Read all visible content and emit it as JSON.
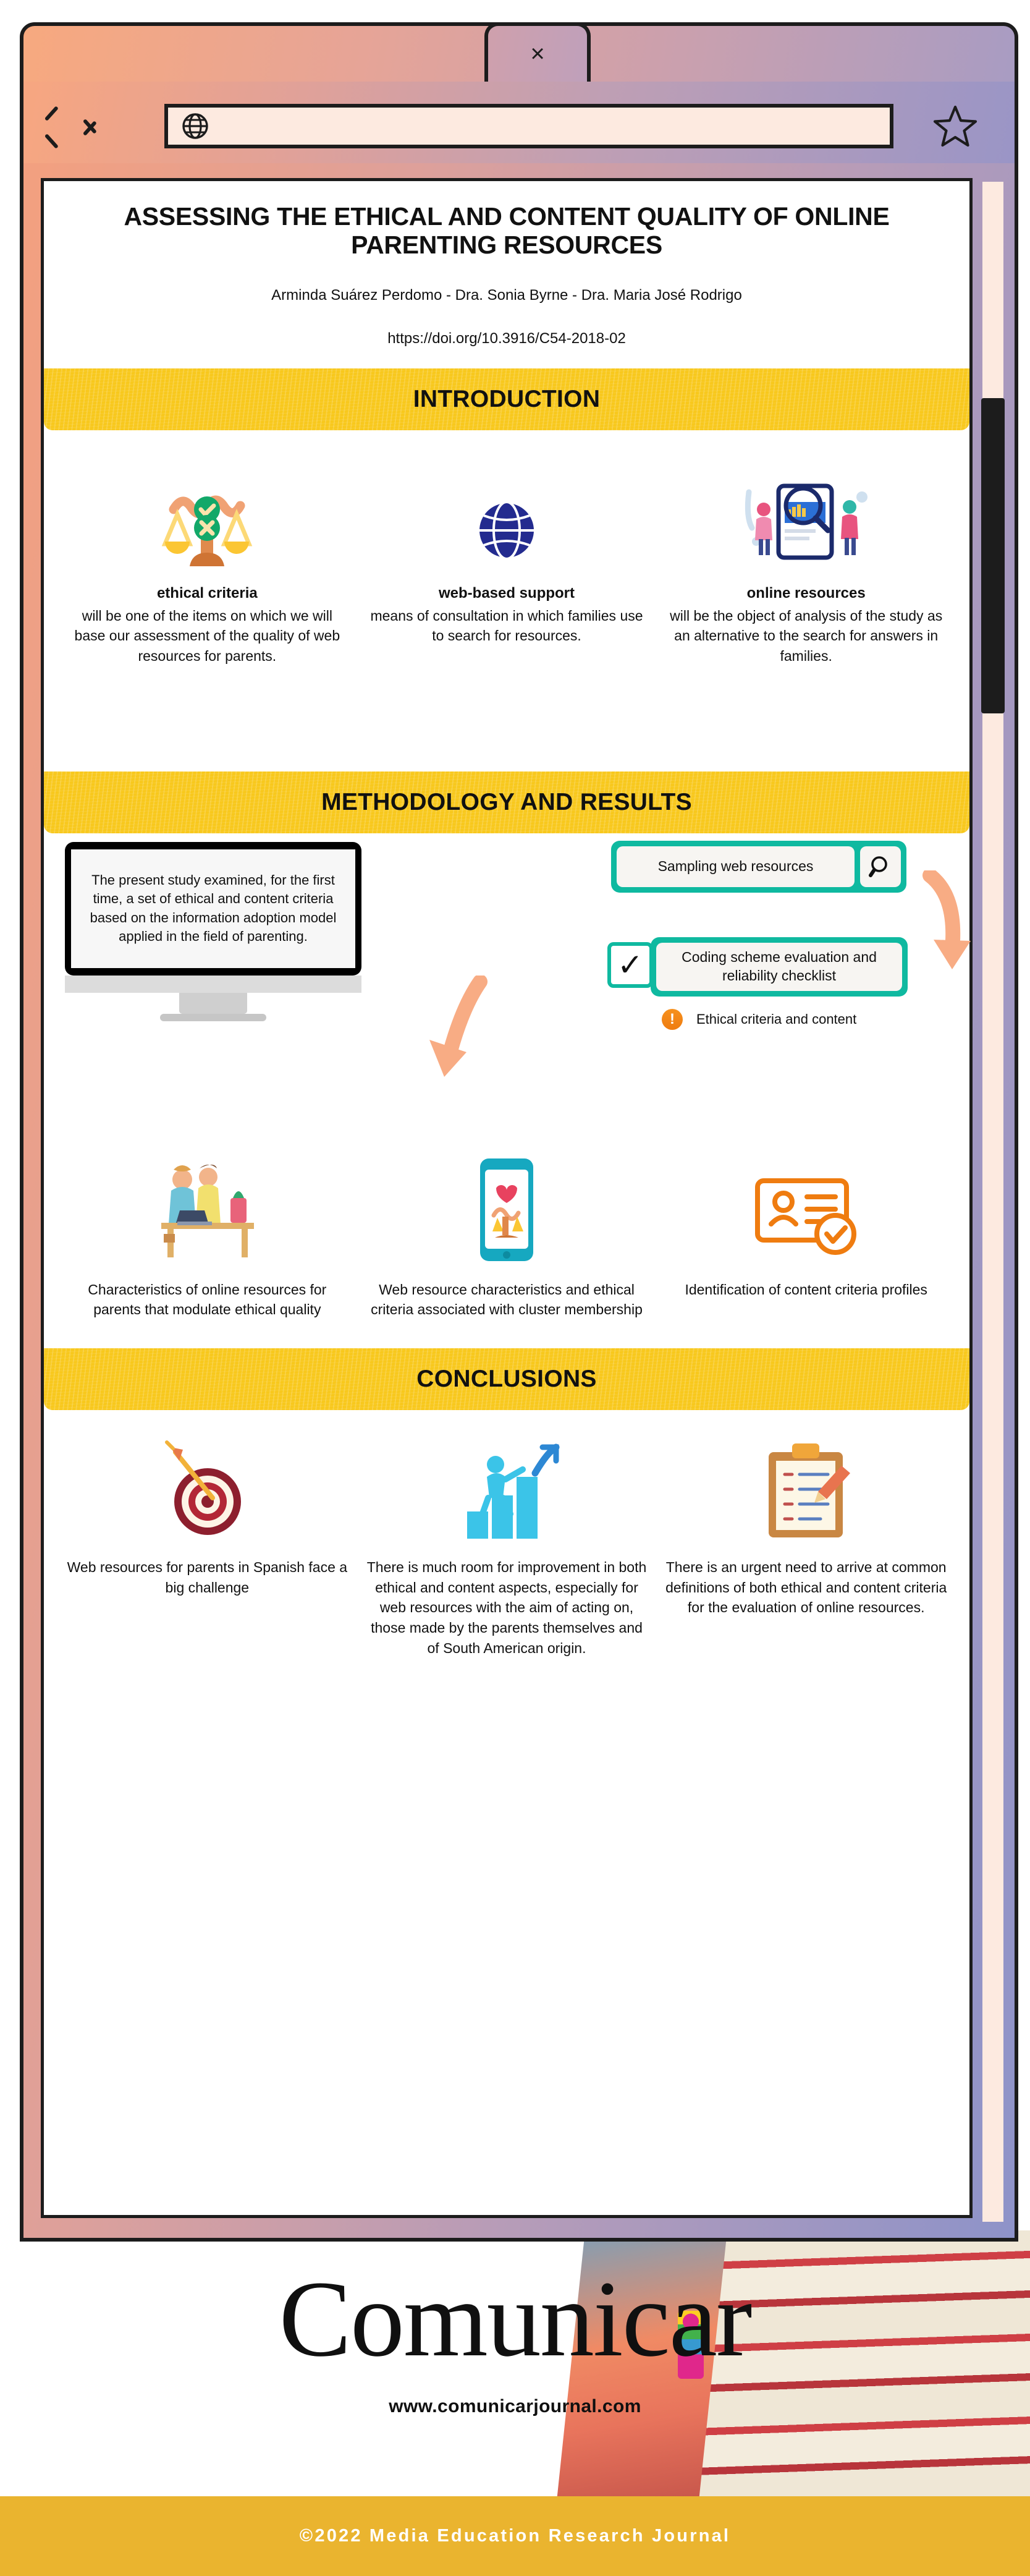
{
  "browser": {
    "tab_close_label": "×",
    "back_label": "back-arrow",
    "forward_label": "forward-arrow",
    "url_value": "",
    "url_placeholder": "",
    "bookmark_label": "bookmark-star"
  },
  "poster": {
    "title": "ASSESSING THE ETHICAL AND CONTENT QUALITY OF ONLINE PARENTING RESOURCES",
    "authors": "Arminda Suárez Perdomo - Dra. Sonia Byrne - Dra. Maria José Rodrigo",
    "doi": "https://doi.org/10.3916/C54-2018-02",
    "sections": {
      "introduction": {
        "heading": "INTRODUCTION",
        "columns": [
          {
            "icon": "balance-scale-icon",
            "title": "ethical criteria",
            "body": "will be one of the items on which we will base our assessment of the quality of web resources for parents."
          },
          {
            "icon": "globe-icon",
            "title": "web-based support",
            "body": "means of consultation in which families use to search for resources."
          },
          {
            "icon": "online-research-icon",
            "title": "online resources",
            "body": "will be the object of analysis of the study as an alternative to the search for answers in families."
          }
        ]
      },
      "methodology": {
        "heading": "METHODOLOGY AND RESULTS",
        "monitor_text": "The present study examined, for the first time, a set of ethical and content criteria based on the information adoption model applied in the field of parenting.",
        "search_box": {
          "value": "Sampling web resources",
          "icon": "search-icon"
        },
        "checklist_box": {
          "value": "Coding scheme evaluation and reliability checklist",
          "check_icon": "check-icon"
        },
        "warning": {
          "icon": "alert-icon",
          "label": "Ethical criteria and content"
        },
        "results": [
          {
            "icon": "family-computer-icon",
            "body": "Characteristics of online resources for parents that modulate ethical quality"
          },
          {
            "icon": "mobile-analysis-icon",
            "body": "Web resource characteristics and ethical criteria associated with cluster membership"
          },
          {
            "icon": "id-profile-icon",
            "body": "Identification of content criteria profiles"
          }
        ]
      },
      "conclusions": {
        "heading": "CONCLUSIONS",
        "columns": [
          {
            "icon": "target-dart-icon",
            "body": "Web resources for parents in Spanish face a big challenge"
          },
          {
            "icon": "growth-steps-icon",
            "body": "There is much room for improvement in both ethical and content aspects, especially for web resources with the aim of acting on, those made by the parents themselves and of South American origin."
          },
          {
            "icon": "clipboard-checklist-icon",
            "body": "There is an urgent need to arrive at common definitions of both ethical and content criteria for the evaluation of online resources."
          }
        ]
      }
    }
  },
  "footer": {
    "brand": "Comunicar",
    "url": "www.comunicarjournal.com",
    "copyright": "©2022 Media Education Research Journal"
  },
  "colors": {
    "band_yellow": "#f8c81c",
    "teal": "#0fb9a0",
    "peach_arrow": "#f8ac84",
    "copyright_bar": "#eab42f",
    "orange_accent": "#ef7c10"
  }
}
